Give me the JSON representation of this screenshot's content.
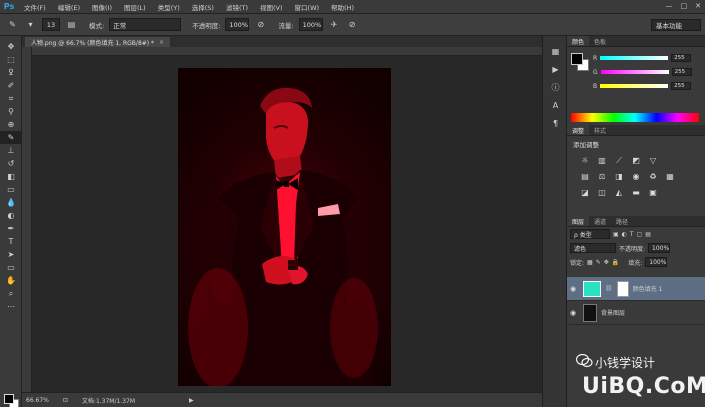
{
  "app": {
    "logo": "Ps",
    "menu": [
      "文件(F)",
      "编辑(E)",
      "图像(I)",
      "图层(L)",
      "类型(Y)",
      "选择(S)",
      "滤镜(T)",
      "视图(V)",
      "窗口(W)",
      "帮助(H)"
    ],
    "window_buttons": [
      "—",
      "□",
      "✕"
    ]
  },
  "options": {
    "brush_size": "13",
    "mode_label": "模式:",
    "mode_value": "正常",
    "opacity_label": "不透明度:",
    "opacity_value": "100%",
    "flow_label": "流量:",
    "flow_value": "100%",
    "workspace": "基本功能"
  },
  "document": {
    "tab_title": "人物.png @ 66.7% (颜色填充 1, RGB/8#) *",
    "tab_close": "×",
    "zoom": "66.67%",
    "doc_info": "文档:1.37M/1.37M"
  },
  "color_panel": {
    "tabs": [
      "颜色",
      "色板"
    ],
    "channels": [
      {
        "label": "R",
        "value": "255",
        "color": "#ff0000"
      },
      {
        "label": "G",
        "value": "255",
        "color": "#00ff00"
      },
      {
        "label": "B",
        "value": "255",
        "color": "#0000ff"
      }
    ]
  },
  "adjustments_panel": {
    "tabs": [
      "调整",
      "样式"
    ],
    "title": "添加调整",
    "icons": [
      "brightness-icon",
      "levels-icon",
      "curves-icon",
      "exposure-icon",
      "vibrance-icon",
      "hue-icon",
      "color-balance-icon",
      "bw-icon",
      "photo-filter-icon",
      "channel-mixer-icon",
      "color-lookup-icon",
      "invert-icon",
      "posterize-icon",
      "threshold-icon",
      "selective-color-icon",
      "gradient-map-icon"
    ]
  },
  "layers_panel": {
    "tabs": [
      "图层",
      "通道",
      "路径"
    ],
    "kind_filter": "ρ 类型",
    "blend_mode": "滤色",
    "opacity_label": "不透明度:",
    "opacity_value": "100%",
    "lock_label": "锁定:",
    "fill_label": "填充:",
    "fill_value": "100%",
    "layers": [
      {
        "name": "颜色填充 1",
        "selected": true
      },
      {
        "name": "背景图层",
        "selected": false
      }
    ]
  },
  "watermark": {
    "line1": "小钱学设计",
    "line2": "UiBQ.CoM"
  },
  "colors": {
    "fill_swatch": "#29e2c1",
    "accent_red": "#ff1030",
    "selected_layer": "#5d6e85"
  }
}
